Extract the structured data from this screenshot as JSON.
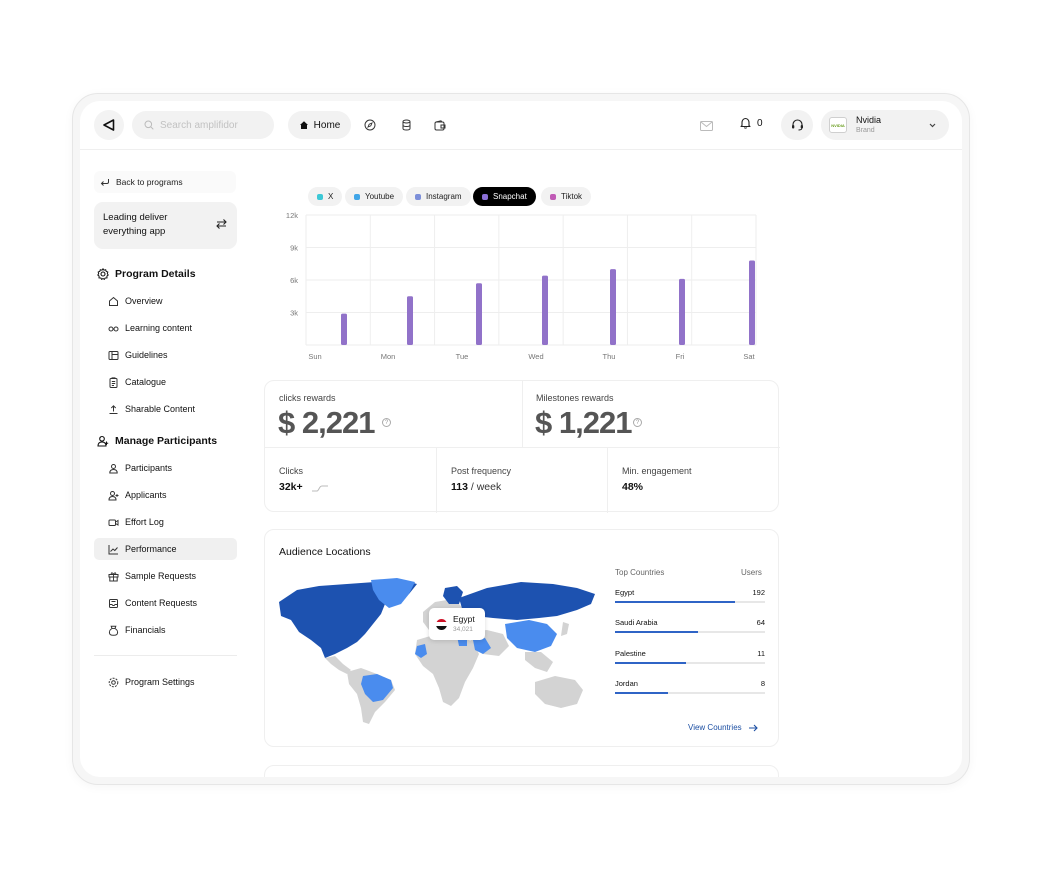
{
  "search": {
    "placeholder": "Search amplifidor"
  },
  "topnav": {
    "home_label": "Home",
    "notifications_count": "0"
  },
  "brand": {
    "name": "Nvidia",
    "subtitle": "Brand",
    "logo_text": "NVIDIA"
  },
  "sidebar": {
    "back_label": "Back to programs",
    "program_name": "Leading deliver everything app",
    "section1_title": "Program Details",
    "section1_items": [
      {
        "label": "Overview",
        "icon": "home-icon"
      },
      {
        "label": "Learning content",
        "icon": "glasses-icon"
      },
      {
        "label": "Guidelines",
        "icon": "layout-icon"
      },
      {
        "label": "Catalogue",
        "icon": "clipboard-icon"
      },
      {
        "label": "Sharable Content",
        "icon": "upload-icon"
      }
    ],
    "section2_title": "Manage Participants",
    "section2_items": [
      {
        "label": "Participants",
        "icon": "user-icon"
      },
      {
        "label": "Applicants",
        "icon": "user-plus-icon"
      },
      {
        "label": "Effort Log",
        "icon": "video-icon"
      },
      {
        "label": "Performance",
        "icon": "chart-line-icon",
        "active": true
      },
      {
        "label": "Sample Requests",
        "icon": "gift-icon"
      },
      {
        "label": "Content Requests",
        "icon": "inbox-icon"
      },
      {
        "label": "Financials",
        "icon": "money-bag-icon"
      }
    ],
    "settings_label": "Program Settings"
  },
  "platform_tabs": [
    {
      "label": "X",
      "color": "#3cc8d6"
    },
    {
      "label": "Youtube",
      "color": "#41a6e8"
    },
    {
      "label": "Instagram",
      "color": "#7c8fd9"
    },
    {
      "label": "Snapchat",
      "color": "#8b6fd6",
      "active": true
    },
    {
      "label": "Tiktok",
      "color": "#c05ab5"
    }
  ],
  "chart_data": {
    "type": "bar",
    "categories": [
      "Sun",
      "Mon",
      "Tue",
      "Wed",
      "Thu",
      "Fri",
      "Sat"
    ],
    "values": [
      2900,
      4500,
      5700,
      6400,
      7000,
      6100,
      7800
    ],
    "ylim": [
      0,
      12000
    ],
    "yticks": [
      {
        "value": 12000,
        "label": "12k"
      },
      {
        "value": 9000,
        "label": "9k"
      },
      {
        "value": 6000,
        "label": "6k"
      },
      {
        "value": 3000,
        "label": "3k"
      }
    ],
    "bar_color": "#9172c9",
    "grid": true
  },
  "rewards": {
    "clicks_label": "clicks rewards",
    "clicks_value": "$ 2,221",
    "milestones_label": "Milestones rewards",
    "milestones_value": "$ 1,221"
  },
  "metrics": {
    "clicks_label": "Clicks",
    "clicks_value": "32k+",
    "post_freq_label": "Post frequency",
    "post_freq_value": "113",
    "post_freq_unit": "/ week",
    "engagement_label": "Min. engagement",
    "engagement_value": "48%"
  },
  "audience": {
    "title": "Audience Locations",
    "col_country": "Top Countries",
    "col_users": "Users",
    "countries": [
      {
        "name": "Egypt",
        "users": "192",
        "fraction": 0.8
      },
      {
        "name": "Saudi Arabia",
        "users": "64",
        "fraction": 0.55
      },
      {
        "name": "Palestine",
        "users": "11",
        "fraction": 0.47
      },
      {
        "name": "Jordan",
        "users": "8",
        "fraction": 0.35
      }
    ],
    "view_label": "View Countries",
    "tooltip": {
      "name": "Egypt",
      "value": "34,021"
    }
  }
}
